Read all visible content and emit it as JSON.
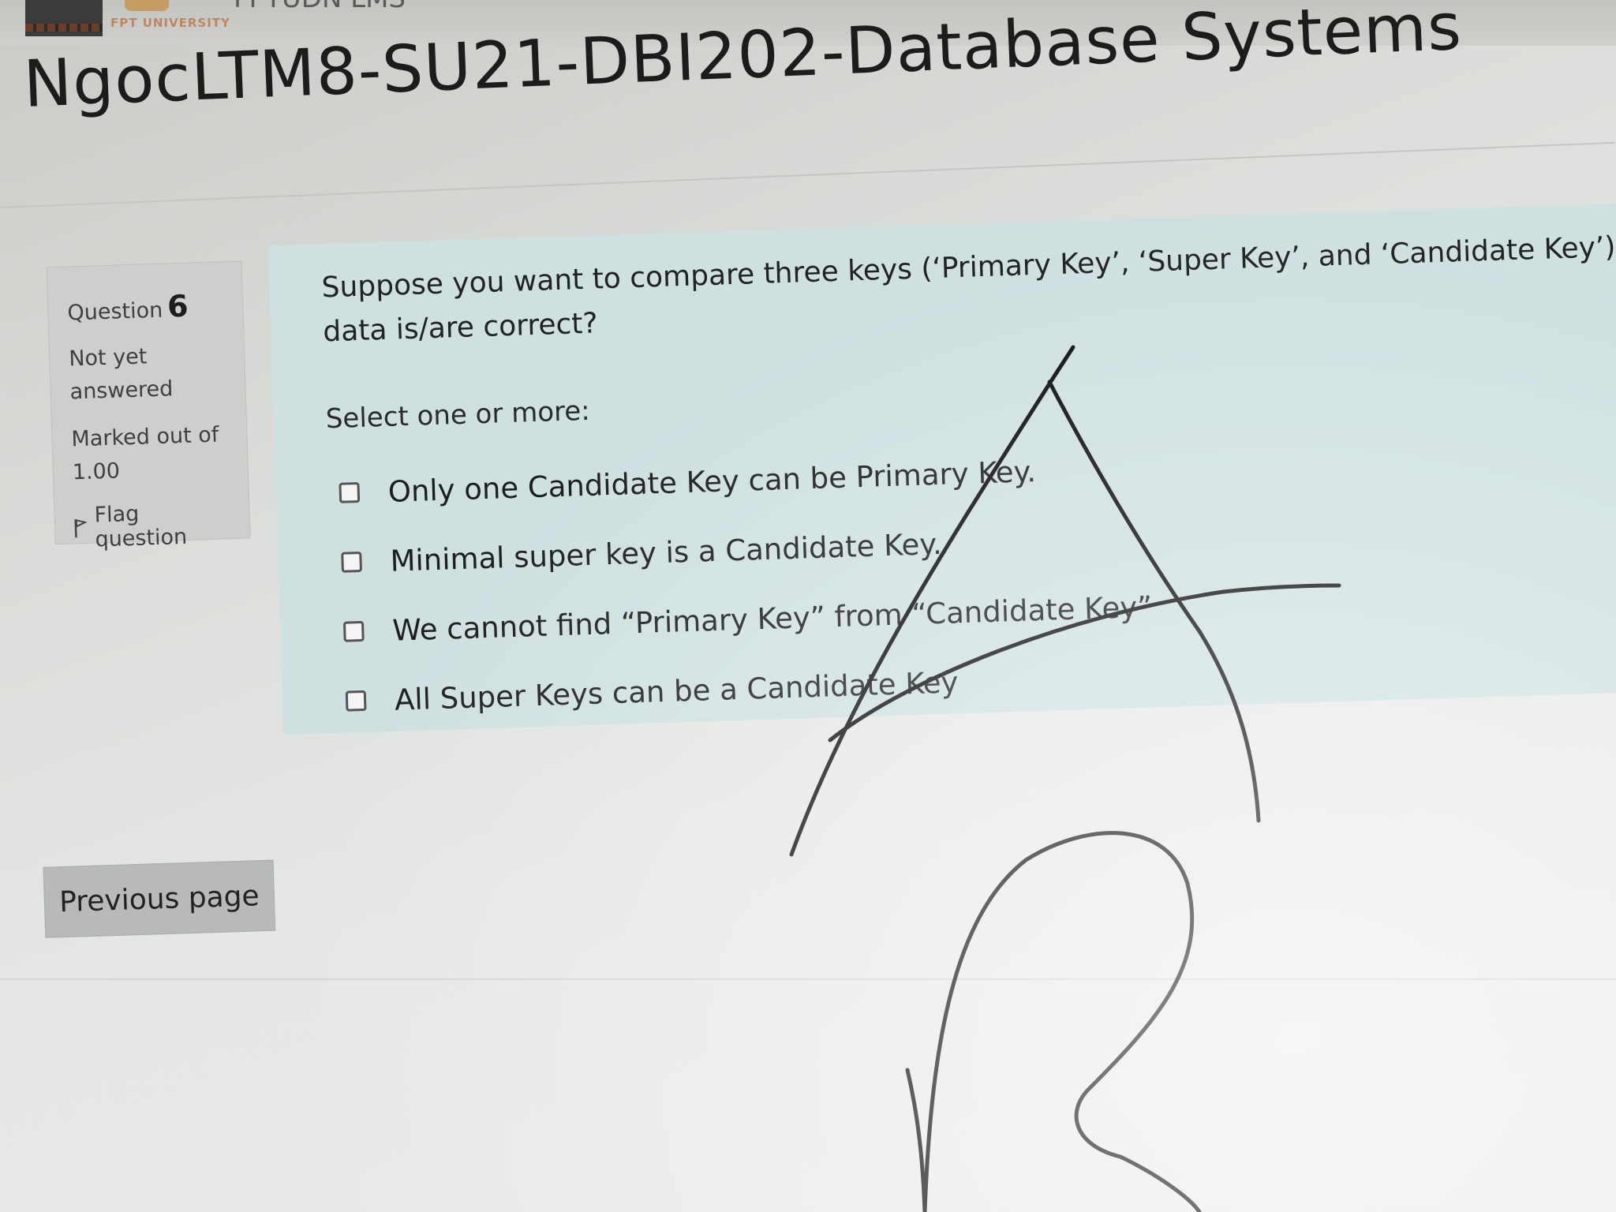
{
  "header": {
    "university": "FPT UNIVERSITY",
    "site_name": "FPTUDN LMS"
  },
  "course_title": "NgocLTM8-SU21-DBI202-Database Systems",
  "question_info": {
    "label": "Question",
    "number": "6",
    "status": "Not yet answered",
    "marked_out_of": "Marked out of 1.00",
    "flag_label": "Flag question"
  },
  "question": {
    "text": "Suppose you want to compare three keys (‘Primary Key’, ‘Super Key’, and ‘Candidate Key’) in data is/are correct?",
    "prompt": "Select one or more:",
    "options": [
      {
        "label": "Only one Candidate Key can be Primary Key.",
        "checked": false
      },
      {
        "label": "Minimal super key is a Candidate Key.",
        "checked": false
      },
      {
        "label": "We cannot find “Primary Key” from “Candidate Key”",
        "checked": false
      },
      {
        "label": "All Super Keys can be a Candidate Key",
        "checked": false
      }
    ]
  },
  "navigation": {
    "previous_label": "Previous page"
  },
  "annotations": {
    "ink_color": "#0d0d0d",
    "marks": [
      "handwritten-letter-A",
      "handwritten-letter-B"
    ]
  }
}
